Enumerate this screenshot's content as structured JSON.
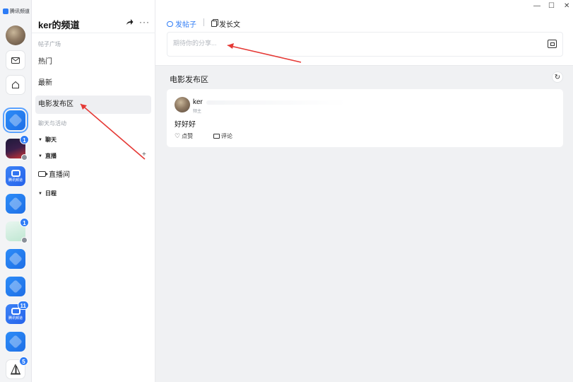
{
  "app": {
    "logo_text": "腾讯频道"
  },
  "rail": {
    "items": [
      {
        "name": "avatar-me"
      },
      {
        "name": "messages-button",
        "icon": "mail-icon"
      },
      {
        "name": "home-button",
        "icon": "home-icon"
      },
      {
        "name": "channel-current",
        "style": "blue"
      },
      {
        "name": "channel-dark",
        "badge": "1"
      },
      {
        "name": "channel-hash-1",
        "caption": "腾讯频道"
      },
      {
        "name": "channel-blue-2"
      },
      {
        "name": "channel-green",
        "badge": "1"
      },
      {
        "name": "channel-blue-3"
      },
      {
        "name": "channel-blue-4"
      },
      {
        "name": "channel-hash-2",
        "caption": "腾讯频道",
        "badge": "11"
      },
      {
        "name": "channel-blue-5"
      },
      {
        "name": "channel-white",
        "badge": "5"
      }
    ]
  },
  "sidebar": {
    "title": "ker的频道",
    "share_icon": "share-arrow-icon",
    "more_label": "···",
    "section_posts": "帖子广场",
    "channels": [
      {
        "label": "热门"
      },
      {
        "label": "最新"
      },
      {
        "label": "电影发布区"
      }
    ],
    "section_chat": "聊天与活动",
    "groups": [
      {
        "label": "聊天"
      },
      {
        "label": "直播"
      },
      {
        "label": "日程"
      }
    ],
    "add_label": "+",
    "live_room_label": "直播间"
  },
  "window": {
    "minimize": "—",
    "maximize": "☐",
    "close": "✕"
  },
  "composer": {
    "tab_post": "发帖子",
    "tab_long": "发长文",
    "placeholder": "期待你的分享..."
  },
  "zone": {
    "title": "电影发布区",
    "refresh_label": "↻"
  },
  "post": {
    "author": "ker",
    "role": "频主",
    "body": "好好好",
    "like_label": "点赞",
    "comment_label": "评论"
  },
  "colors": {
    "accent": "#2f7cf6",
    "annotation": "#e53935"
  }
}
